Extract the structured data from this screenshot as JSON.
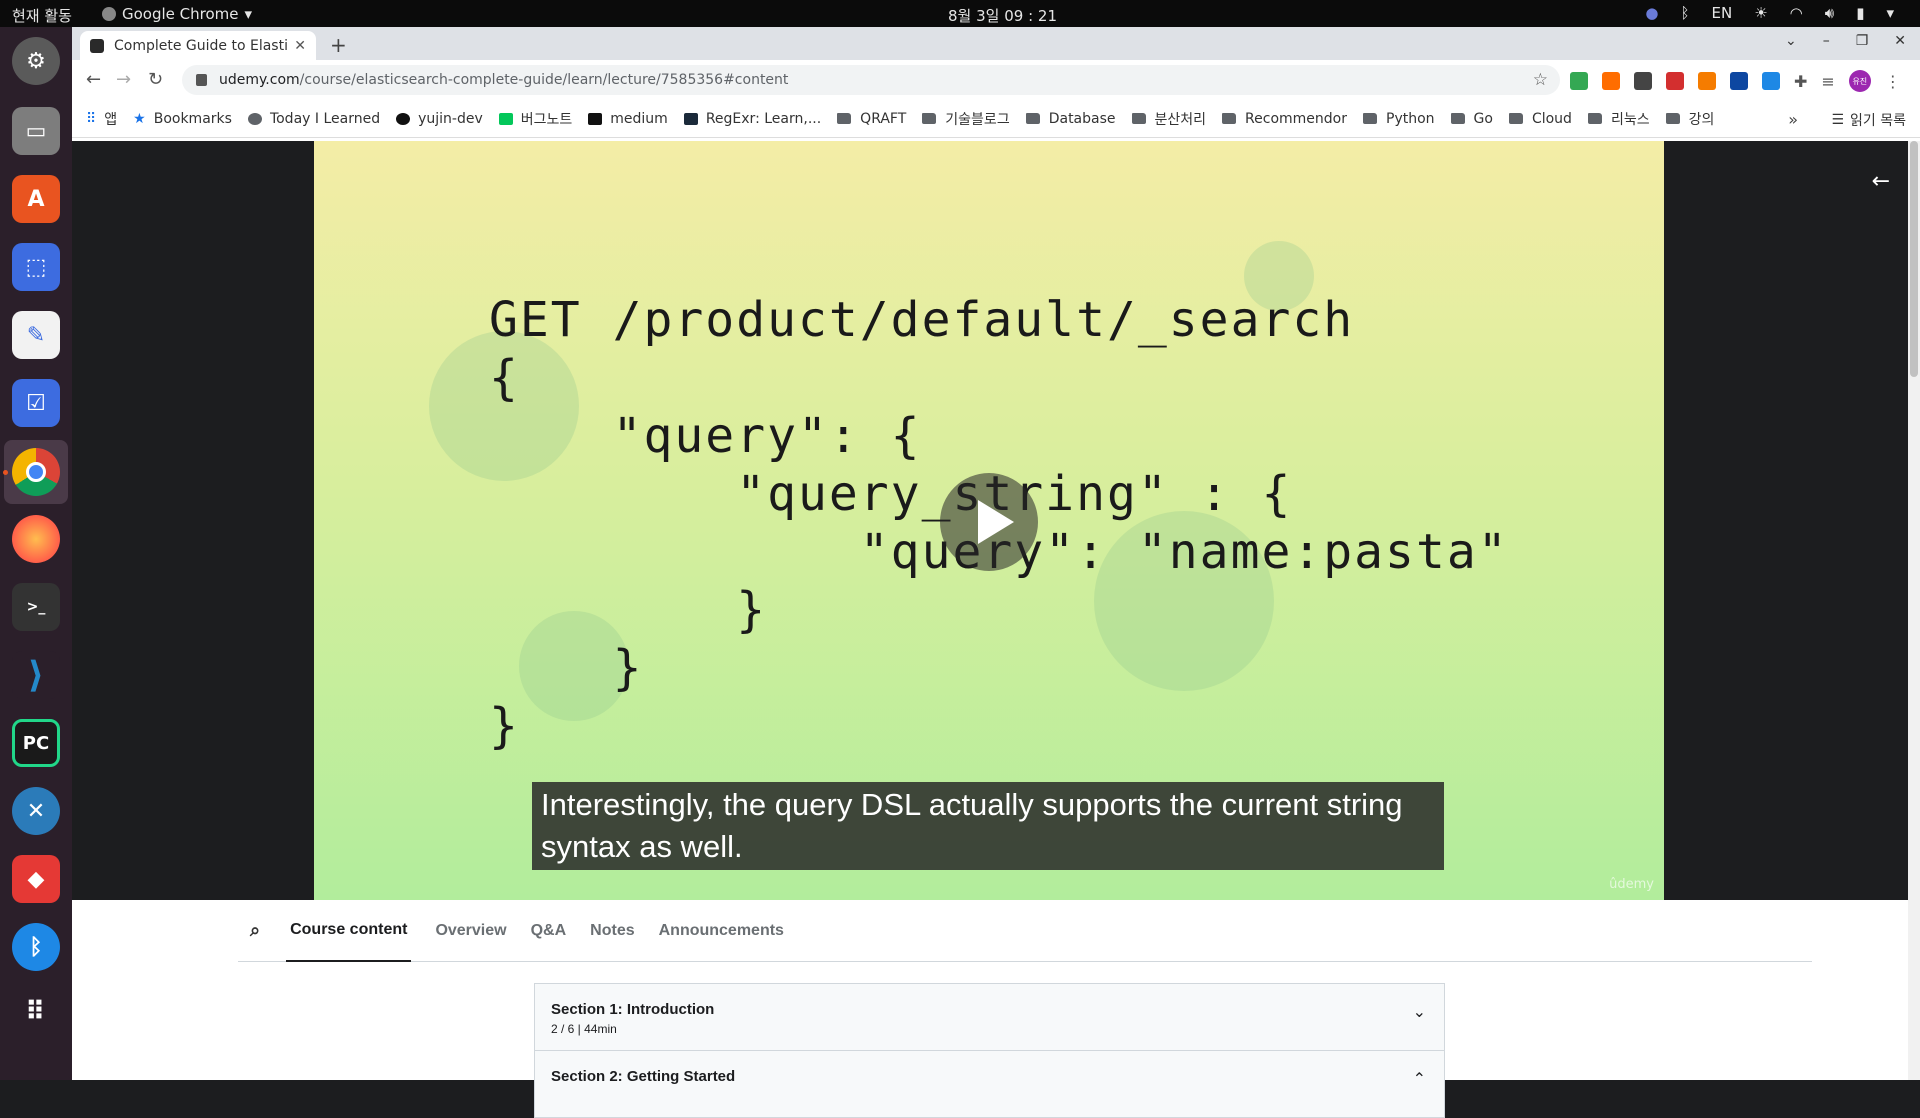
{
  "system": {
    "activities": "현재 활동",
    "app_menu": "Google Chrome",
    "clock": "8월 3일  09 : 21",
    "input_lang": "EN"
  },
  "browser": {
    "tab_title": "Complete Guide to Elastic",
    "url_host": "udemy.com",
    "url_path": "/course/elasticsearch-complete-guide/learn/lecture/7585356#content",
    "bookmarks": [
      "앱",
      "Bookmarks",
      "Today I Learned",
      "yujin-dev",
      "버그노트",
      "medium",
      "RegExr: Learn,...",
      "QRAFT",
      "기술블로그",
      "Database",
      "분산처리",
      "Recommendor",
      "Python",
      "Go",
      "Cloud",
      "리눅스",
      "강의"
    ],
    "reading_list": "읽기 목록",
    "avatar_text": "유진"
  },
  "video": {
    "code_lines": [
      "GET /product/default/_search",
      "{",
      "    \"query\": {",
      "        \"query_string\" : {",
      "            \"query\": \"name:pasta\"",
      "        }",
      "    }",
      "}"
    ],
    "subtitle": "Interestingly, the query DSL actually supports the current string syntax as well.",
    "watermark": "ûdemy"
  },
  "course_tabs": [
    "Course content",
    "Overview",
    "Q&A",
    "Notes",
    "Announcements"
  ],
  "sections": [
    {
      "title": "Section 1: Introduction",
      "meta": "2 / 6 | 44min"
    },
    {
      "title": "Section 2: Getting Started",
      "meta": ""
    }
  ]
}
